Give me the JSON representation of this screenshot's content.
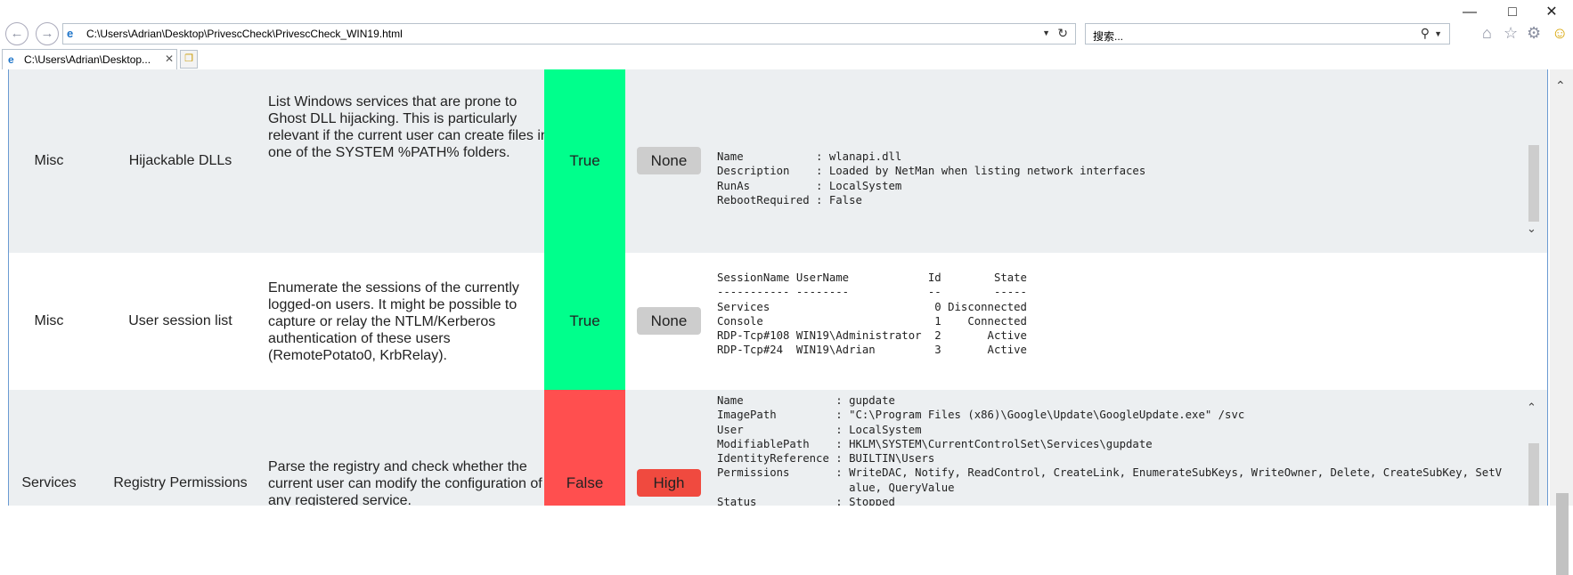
{
  "browser": {
    "address": "C:\\Users\\Adrian\\Desktop\\PrivescCheck\\PrivescCheck_WIN19.html",
    "search_placeholder": "搜索...",
    "tab_title": "C:\\Users\\Adrian\\Desktop...",
    "icons": [
      "back-icon",
      "forward-icon",
      "ie-logo-icon",
      "dropdown-icon",
      "refresh-icon",
      "search-icon",
      "home-icon",
      "favorites-star-icon",
      "settings-gear-icon",
      "smiley-feedback-icon",
      "close-tab-icon",
      "new-tab-icon",
      "minimize-icon",
      "maximize-icon",
      "close-window-icon"
    ]
  },
  "colors": {
    "true_green": "#00ff8c",
    "false_red": "#ff4f4f",
    "none_gray": "#cdcdcd",
    "high_red": "#f04a3f",
    "row_gray": "#eceff1"
  },
  "rows": [
    {
      "category": "Misc",
      "check": "Hijackable DLLs",
      "description": "List Windows services that are prone to Ghost DLL hijacking. This is particularly relevant if the current user can create files in one of the SYSTEM %PATH% folders.",
      "result": "True",
      "severity": "None",
      "output": "Name           : wlanapi.dll\nDescription    : Loaded by NetMan when listing network interfaces\nRunAs          : LocalSystem\nRebootRequired : False"
    },
    {
      "category": "Misc",
      "check": "User session list",
      "description": "Enumerate the sessions of the currently logged-on users. It might be possible to capture or relay the NTLM/Kerberos authentication of these users (RemotePotato0, KrbRelay).",
      "result": "True",
      "severity": "None",
      "output": "SessionName UserName            Id        State\n----------- --------            --        -----\nServices                         0 Disconnected\nConsole                          1    Connected\nRDP-Tcp#108 WIN19\\Administrator  2       Active\nRDP-Tcp#24  WIN19\\Adrian         3       Active"
    },
    {
      "category": "Services",
      "check": "Registry Permissions",
      "description": "Parse the registry and check whether the current user can modify the configuration of any registered service.",
      "result": "False",
      "severity": "High",
      "output": "Name              : gupdate\nImagePath         : \"C:\\Program Files (x86)\\Google\\Update\\GoogleUpdate.exe\" /svc\nUser              : LocalSystem\nModifiablePath    : HKLM\\SYSTEM\\CurrentControlSet\\Services\\gupdate\nIdentityReference : BUILTIN\\Users\nPermissions       : WriteDAC, Notify, ReadControl, CreateLink, EnumerateSubKeys, WriteOwner, Delete, CreateSubKey, SetV\n                    alue, QueryValue\nStatus            : Stopped\nUserCanStart      : True\nUserCanStop       : True"
    }
  ]
}
